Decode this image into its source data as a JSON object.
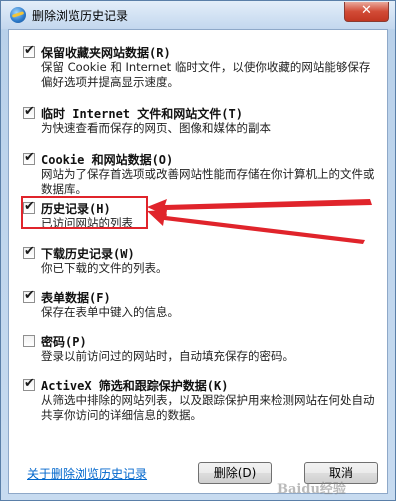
{
  "window": {
    "title": "删除浏览历史记录",
    "close_glyph": "✕"
  },
  "options": [
    {
      "checked": true,
      "title": "保留收藏夹网站数据(R)",
      "desc": "保留 Cookie 和 Internet 临时文件，以使你收藏的网站能够保存偏好选项并提高显示速度。"
    },
    {
      "checked": true,
      "title": "临时 Internet 文件和网站文件(T)",
      "desc": "为快速查看而保存的网页、图像和媒体的副本"
    },
    {
      "checked": true,
      "title": "Cookie 和网站数据(O)",
      "desc": "网站为了保存首选项或改善网站性能而存储在你计算机上的文件或数据库。"
    },
    {
      "checked": true,
      "title": "历史记录(H)",
      "desc": "已访问网站的列表"
    },
    {
      "checked": true,
      "title": "下载历史记录(W)",
      "desc": "你已下载的文件的列表。"
    },
    {
      "checked": true,
      "title": "表单数据(F)",
      "desc": "保存在表单中键入的信息。"
    },
    {
      "checked": false,
      "title": "密码(P)",
      "desc": "登录以前访问过的网站时，自动填充保存的密码。"
    },
    {
      "checked": true,
      "title": "ActiveX 筛选和跟踪保护数据(K)",
      "desc": "从筛选中排除的网站列表，以及跟踪保护用来检测网站在何处自动共享你访问的详细信息的数据。"
    }
  ],
  "check_glyph": "✔",
  "footer": {
    "link": "关于删除浏览历史记录",
    "delete_button": "删除(D)",
    "cancel_button": "取消"
  },
  "watermark": "Baidu经验",
  "annotation": {
    "highlight_color": "#e0242b"
  }
}
